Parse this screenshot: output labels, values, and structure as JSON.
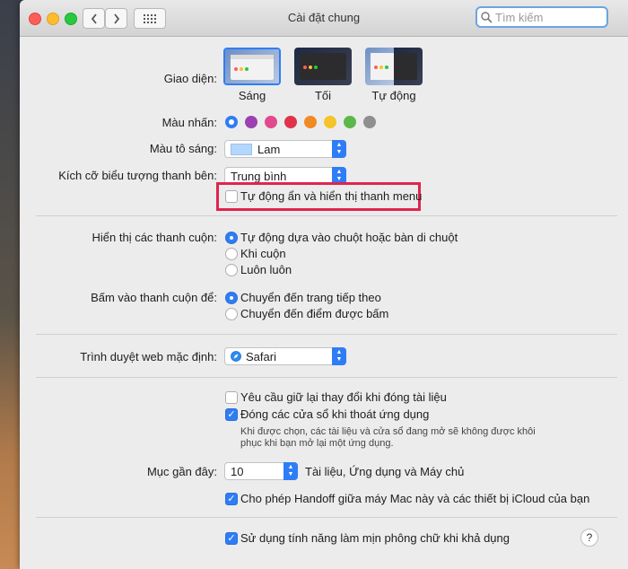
{
  "window": {
    "title": "Cài đặt chung"
  },
  "toolbar": {
    "back_icon": "chevron-left-icon",
    "forward_icon": "chevron-right-icon",
    "grid_icon": "grid-icon",
    "search_placeholder": "Tìm kiếm"
  },
  "appearance": {
    "label": "Giao diện:",
    "options": [
      "Sáng",
      "Tối",
      "Tự động"
    ]
  },
  "accent": {
    "label": "Màu nhấn:",
    "colors": [
      "#2f7df6",
      "#9b41b2",
      "#e14b8e",
      "#e0334a",
      "#f08a24",
      "#f5c32a",
      "#5cb84a",
      "#8f8f8f"
    ]
  },
  "highlight": {
    "label": "Màu tô sáng:",
    "value": "Lam",
    "swatch_color": "#b4d7ff"
  },
  "sidebar_icon_size": {
    "label": "Kích cỡ biểu tượng thanh bên:",
    "value": "Trung bình"
  },
  "auto_hide_menu": {
    "label": "Tự động ẩn và hiển thị thanh menu",
    "checked": false
  },
  "show_scrollbars": {
    "label": "Hiển thị các thanh cuộn:",
    "options": [
      "Tự động dựa vào chuột hoặc bàn di chuột",
      "Khi cuộn",
      "Luôn luôn"
    ],
    "selected": 0
  },
  "click_scrollbar": {
    "label": "Bấm vào thanh cuộn để:",
    "options": [
      "Chuyển đến trang tiếp theo",
      "Chuyển đến điểm được bấm"
    ],
    "selected": 0
  },
  "default_browser": {
    "label": "Trình duyệt web mặc định:",
    "value": "Safari"
  },
  "ask_keep_changes": {
    "label": "Yêu cầu giữ lại thay đổi khi đóng tài liệu",
    "checked": false
  },
  "close_windows": {
    "label": "Đóng các cửa sổ khi thoát ứng dụng",
    "checked": true,
    "note_line1": "Khi được chọn, các tài liệu và cửa sổ đang mở sẽ không được khôi",
    "note_line2": "phục khi bạn mở lại một ứng dụng."
  },
  "recent_items": {
    "label": "Mục gần đây:",
    "value": "10",
    "suffix": "Tài liệu, Ứng dụng và Máy chủ"
  },
  "handoff": {
    "label": "Cho phép Handoff giữa máy Mac này và các thiết bị iCloud của bạn",
    "checked": true
  },
  "font_smoothing": {
    "label": "Sử dụng tính năng làm mịn phông chữ khi khả dụng",
    "checked": true
  },
  "help": {
    "label": "?"
  },
  "colors": {
    "accent": "#2f7df6",
    "callout": "#e0244f"
  }
}
